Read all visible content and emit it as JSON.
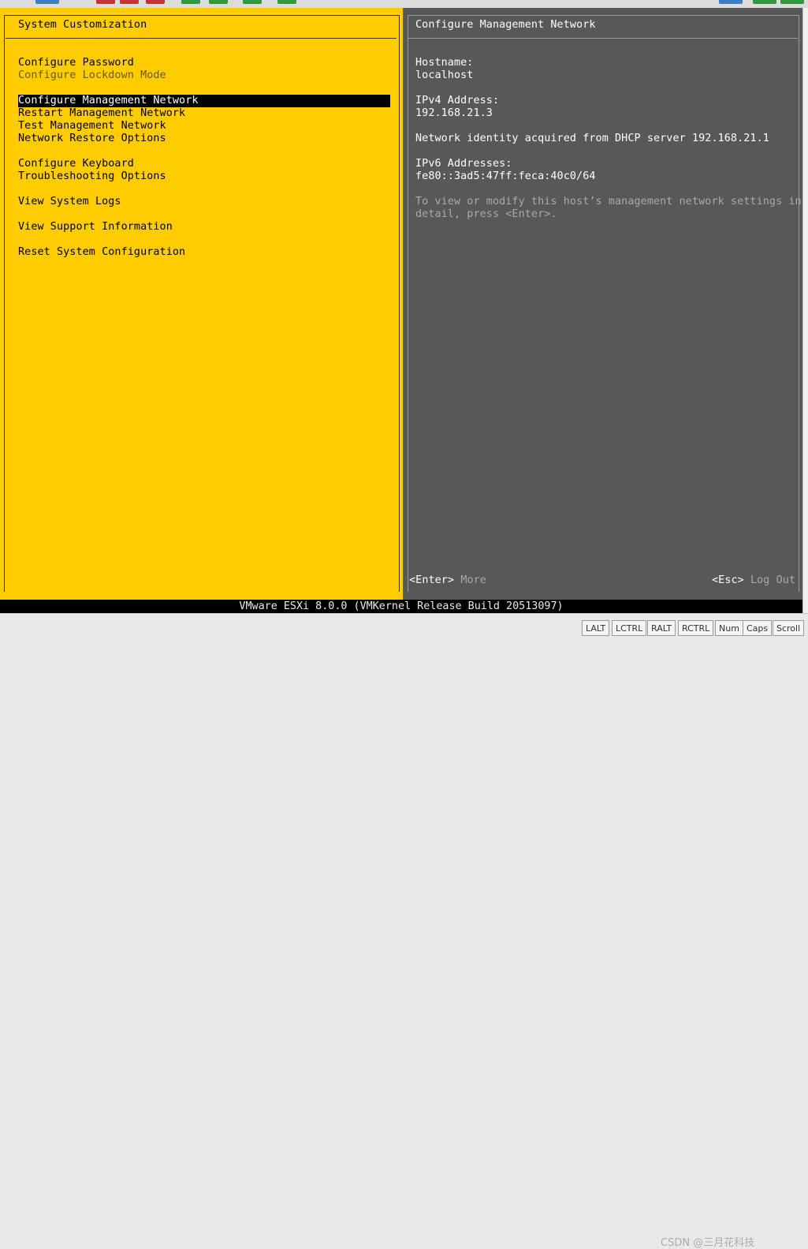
{
  "left_menu": {
    "title": "System Customization",
    "items": [
      {
        "label": "Configure Password"
      },
      {
        "label": "Configure Lockdown Mode"
      },
      {
        "label": "Configure Management Network"
      },
      {
        "label": "Restart Management Network"
      },
      {
        "label": "Test Management Network"
      },
      {
        "label": "Network Restore Options"
      },
      {
        "label": "Configure Keyboard"
      },
      {
        "label": "Troubleshooting Options"
      },
      {
        "label": "View System Logs"
      },
      {
        "label": "View Support Information"
      },
      {
        "label": "Reset System Configuration"
      }
    ]
  },
  "detail": {
    "title": "Configure Management Network",
    "hostname_label": "Hostname:",
    "hostname_value": "localhost",
    "ipv4_label": "IPv4 Address:",
    "ipv4_value": "192.168.21.3",
    "dhcp_note": "Network identity acquired from DHCP server 192.168.21.1",
    "ipv6_label": "IPv6 Addresses:",
    "ipv6_value": "fe80::3ad5:47ff:feca:40c0/64",
    "hint_line1": "To view or modify this host’s management network settings in",
    "hint_line2": "detail, press <Enter>."
  },
  "footer": {
    "enter_key": "<Enter>",
    "enter_action": "More",
    "esc_key": "<Esc>",
    "esc_action": "Log Out"
  },
  "status_bar": "VMware ESXi 8.0.0 (VMKernel Release Build 20513097)",
  "key_buttons": [
    "LALT",
    "LCTRL",
    "RALT",
    "RCTRL",
    "Num",
    "Caps",
    "Scroll"
  ],
  "watermark": "CSDN @三月花科技",
  "colors": {
    "left_bg": "#ffcc00",
    "right_bg": "#585858",
    "selected_bg": "#000000",
    "selected_fg": "#ffffff"
  }
}
